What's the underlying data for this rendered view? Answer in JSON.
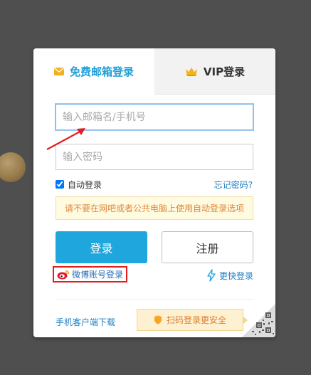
{
  "tabs": {
    "mail_label": "免费邮箱登录",
    "mail_icon": "envelope-icon",
    "vip_label": "VIP登录",
    "vip_icon": "crown-icon"
  },
  "form": {
    "email_placeholder": "输入邮箱名/手机号",
    "email_value": "",
    "password_placeholder": "输入密码",
    "password_value": "",
    "auto_login_label": "自动登录",
    "auto_login_checked": true,
    "forgot_password": "忘记密码?",
    "notice": "请不要在网吧或者公共电脑上使用自动登录选项",
    "login_button": "登录",
    "register_button": "注册"
  },
  "alt_login": {
    "weibo_label": "微博账号登录",
    "weibo_icon": "weibo-icon",
    "quick_label": "更快登录",
    "quick_icon": "lightning-icon"
  },
  "footer": {
    "mobile_download": "手机客户端下载",
    "qr_tip": "扫码登录更安全",
    "qr_tip_icon": "shield-icon",
    "qr_icon": "qr-code-icon"
  },
  "colors": {
    "accent": "#1fa7dd",
    "page_background": "#4f4f4f",
    "notice_text": "#e0873f",
    "annotation_red": "#e02020"
  }
}
